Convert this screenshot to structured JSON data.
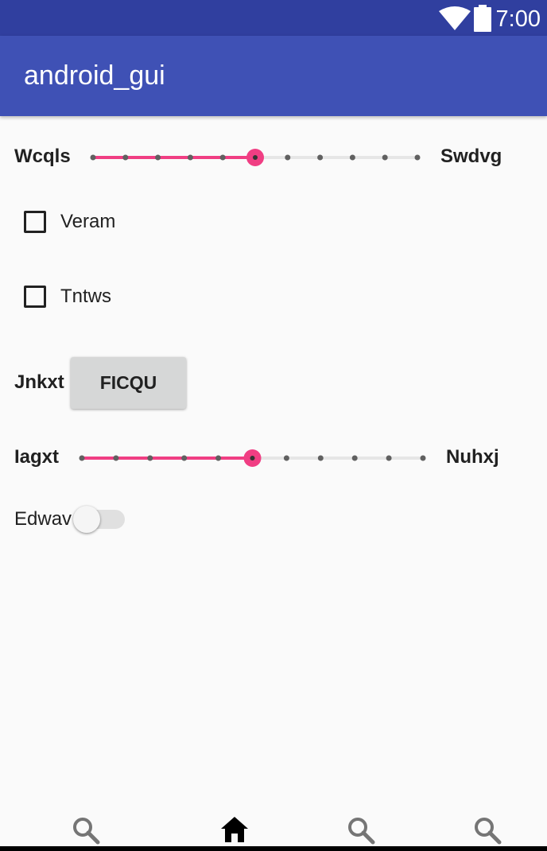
{
  "status_bar": {
    "time": "7:00",
    "icons": [
      "wifi-icon",
      "battery-icon"
    ],
    "background": "#303f9f"
  },
  "app_bar": {
    "title": "android_gui",
    "background": "#3f51b5"
  },
  "slider_1": {
    "min_label": "Wcqls",
    "max_label": "Swdvg",
    "steps": 10,
    "value": 5,
    "accent": "#f03e83"
  },
  "checkboxes": [
    {
      "label": "Veram",
      "checked": false
    },
    {
      "label": "Tntws",
      "checked": false
    }
  ],
  "button_row": {
    "label": "Jnkxt",
    "button_label": "FICQU"
  },
  "slider_2": {
    "min_label": "Iagxt",
    "max_label": "Nuhxj",
    "steps": 10,
    "value": 5,
    "accent": "#f03e83"
  },
  "switch_row": {
    "label": "Edwav",
    "on": false
  },
  "bottom_nav": {
    "items": [
      "search-icon",
      "home-icon",
      "search-icon",
      "search-icon"
    ]
  }
}
